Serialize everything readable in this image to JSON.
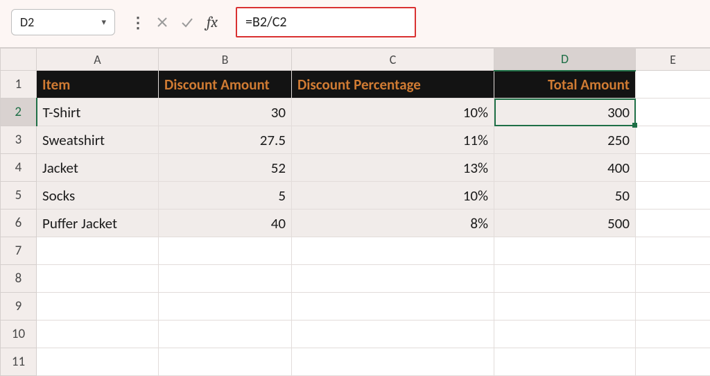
{
  "namebox": {
    "value": "D2"
  },
  "formula": {
    "value": "=B2/C2"
  },
  "columns": {
    "A": "A",
    "B": "B",
    "C": "C",
    "D": "D",
    "E": "E"
  },
  "rows": [
    "1",
    "2",
    "3",
    "4",
    "5",
    "6",
    "7",
    "8",
    "9",
    "10",
    "11"
  ],
  "headers": {
    "A": "Item",
    "B": "Discount Amount",
    "C": "Discount Percentage",
    "D": "Total Amount"
  },
  "data": [
    {
      "item": "T-Shirt",
      "discAmt": "30",
      "discPct": "10%",
      "total": "300"
    },
    {
      "item": "Sweatshirt",
      "discAmt": "27.5",
      "discPct": "11%",
      "total": "250"
    },
    {
      "item": "Jacket",
      "discAmt": "52",
      "discPct": "13%",
      "total": "400"
    },
    {
      "item": "Socks",
      "discAmt": "5",
      "discPct": "10%",
      "total": "50"
    },
    {
      "item": "Puffer Jacket",
      "discAmt": "40",
      "discPct": "8%",
      "total": "500"
    }
  ],
  "activeCell": "D2",
  "activeCol": "D",
  "activeRow": "2",
  "chart_data": {
    "type": "table",
    "columns": [
      "Item",
      "Discount Amount",
      "Discount Percentage",
      "Total Amount"
    ],
    "rows": [
      [
        "T-Shirt",
        30,
        "10%",
        300
      ],
      [
        "Sweatshirt",
        27.5,
        "11%",
        250
      ],
      [
        "Jacket",
        52,
        "13%",
        400
      ],
      [
        "Socks",
        5,
        "10%",
        50
      ],
      [
        "Puffer Jacket",
        40,
        "8%",
        500
      ]
    ]
  }
}
